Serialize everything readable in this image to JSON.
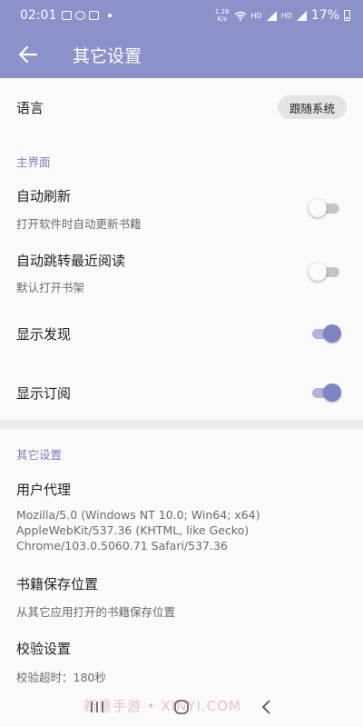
{
  "statusbar": {
    "time": "02:01",
    "net_speed_top": "1.28",
    "net_speed_bottom": "K/s",
    "sim1": "HD",
    "sim2": "HD",
    "battery": "17%"
  },
  "appbar": {
    "title": "其它设置",
    "back_icon": "arrow-left-icon"
  },
  "language": {
    "label": "语言",
    "value": "跟随系统"
  },
  "sections": {
    "main_ui": "主界面",
    "other": "其它设置"
  },
  "auto_refresh": {
    "label": "自动刷新",
    "sub": "打开软件时自动更新书籍",
    "on": false
  },
  "auto_jump": {
    "label": "自动跳转最近阅读",
    "sub": "默认打开书架",
    "on": false
  },
  "show_discover": {
    "label": "显示发现",
    "on": true
  },
  "show_subscribe": {
    "label": "显示订阅",
    "on": true
  },
  "user_agent": {
    "label": "用户代理",
    "value": "Mozilla/5.0 (Windows NT 10.0; Win64; x64) AppleWebKit/537.36 (KHTML, like Gecko) Chrome/103.0.5060.71 Safari/537.36"
  },
  "book_location": {
    "label": "书籍保存位置",
    "sub": "从其它应用打开的书籍保存位置"
  },
  "verify": {
    "label": "校验设置",
    "sub": "校验超时：180秒"
  },
  "watermark": "新意手游 • XINYI.COM",
  "colors": {
    "primary": "#8b91c9",
    "accent": "#7d84c3",
    "section_text": "#7a7fb8"
  }
}
